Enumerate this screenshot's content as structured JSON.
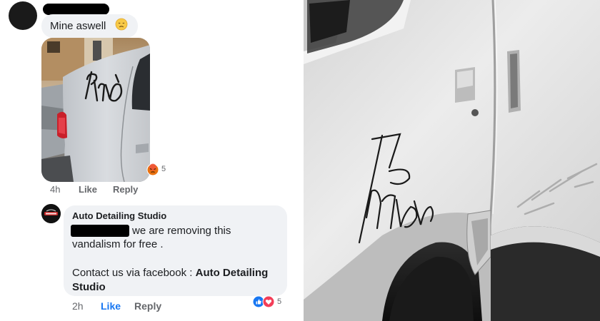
{
  "comment1": {
    "text": "Mine aswell",
    "emoji_icon": "sad-face-icon",
    "reaction_icon": "angry-reaction-icon",
    "reaction_count": "5",
    "time": "4h",
    "like_label": "Like",
    "reply_label": "Reply",
    "photo_scrawl": "Porto"
  },
  "comment2": {
    "author": "Auto Detailing Studio",
    "line1": "we are removing this",
    "line2": "vandalism for free .",
    "line3_prefix": "Contact us via facebook : ",
    "line3_bold": "Auto Detailing",
    "line4": "Studio",
    "reaction_icons": [
      "like-reaction-icon",
      "love-reaction-icon"
    ],
    "reaction_count": "5",
    "time": "2h",
    "like_label": "Like",
    "reply_label": "Reply"
  },
  "right_photo": {
    "graffiti_text": "Porto",
    "colors": {
      "van": "#e6e6e6",
      "shadow": "#1e1e1e"
    }
  },
  "colors": {
    "bubble": "#f0f2f5",
    "meta": "#65676b",
    "like_active": "#1877f2"
  }
}
